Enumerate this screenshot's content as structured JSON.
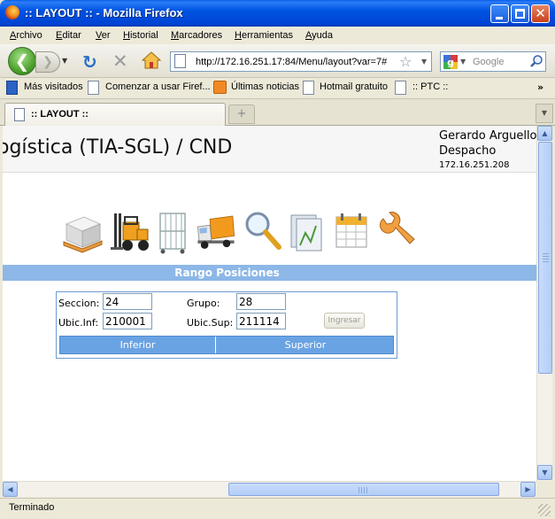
{
  "window": {
    "title": ":: LAYOUT :: - Mozilla Firefox"
  },
  "menu": [
    "Archivo",
    "Editar",
    "Ver",
    "Historial",
    "Marcadores",
    "Herramientas",
    "Ayuda"
  ],
  "nav": {
    "url": "http://172.16.251.17:84/Menu/layout?var=7#",
    "search_placeholder": "Google"
  },
  "bookmarks": [
    "Más visitados",
    "Comenzar a usar Firef...",
    "Últimas noticias",
    "Hotmail gratuito",
    ":: PTC ::"
  ],
  "tab": {
    "label": ":: LAYOUT ::"
  },
  "page": {
    "app_title": "ogística (TIA-SGL) / CND",
    "user": {
      "name": "Gerardo Arguello",
      "role": "Despacho",
      "ip": "172.16.251.208"
    },
    "icons": [
      "pallet-icon",
      "forklift-icon",
      "cage-cart-icon",
      "delivery-truck-icon",
      "magnifier-icon",
      "folders-icon",
      "calendar-icon",
      "wrench-icon"
    ],
    "section_title": "Rango Posiciones",
    "form": {
      "seccion_label": "Seccion:",
      "seccion_value": "24",
      "grupo_label": "Grupo:",
      "grupo_value": "28",
      "ubic_inf_label": "Ubic.Inf:",
      "ubic_inf_value": "210001",
      "ubic_sup_label": "Ubic.Sup:",
      "ubic_sup_value": "211114",
      "ingresar_label": "Ingresar"
    },
    "table": {
      "headers": [
        "Inferior",
        "Superior"
      ]
    }
  },
  "status": {
    "text": "Terminado"
  }
}
